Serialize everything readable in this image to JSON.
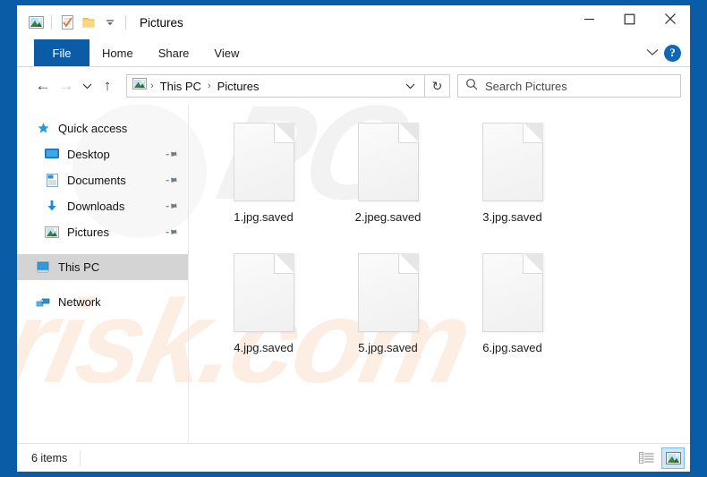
{
  "window": {
    "title": "Pictures",
    "quick_access_toolbar": [
      {
        "name": "pictures-folder-icon",
        "label": "Pictures"
      },
      {
        "name": "properties-icon",
        "label": "Properties"
      },
      {
        "name": "new-folder-icon",
        "label": "New folder"
      },
      {
        "name": "customize-dropdown-icon",
        "label": "Customize Quick Access Toolbar"
      }
    ],
    "controls": {
      "minimize": "─",
      "maximize": "□",
      "close": "✕"
    }
  },
  "ribbon": {
    "tabs": [
      {
        "label": "File",
        "selected": true
      },
      {
        "label": "Home",
        "selected": false
      },
      {
        "label": "Share",
        "selected": false
      },
      {
        "label": "View",
        "selected": false
      }
    ],
    "expand_label": "⌄",
    "help_label": "?"
  },
  "address": {
    "back_label": "←",
    "forward_label": "→",
    "recent_label": "⌄",
    "up_label": "↑",
    "breadcrumb": [
      "This PC",
      "Pictures"
    ],
    "separator": "›",
    "dropdown_label": "⌄",
    "refresh_label": "↻"
  },
  "search": {
    "placeholder": "Search Pictures",
    "value": "",
    "icon_label": "⌕"
  },
  "sidebar": {
    "items": [
      {
        "label": "Quick access",
        "icon": "star-pin-icon",
        "pinned": false,
        "selected": false,
        "indent": false
      },
      {
        "label": "Desktop",
        "icon": "desktop-icon",
        "pinned": true,
        "selected": false,
        "indent": true
      },
      {
        "label": "Documents",
        "icon": "documents-icon",
        "pinned": true,
        "selected": false,
        "indent": true
      },
      {
        "label": "Downloads",
        "icon": "downloads-icon",
        "pinned": true,
        "selected": false,
        "indent": true
      },
      {
        "label": "Pictures",
        "icon": "pictures-icon",
        "pinned": true,
        "selected": false,
        "indent": true
      },
      {
        "label": "This PC",
        "icon": "this-pc-icon",
        "pinned": false,
        "selected": true,
        "indent": false
      },
      {
        "label": "Network",
        "icon": "network-icon",
        "pinned": false,
        "selected": false,
        "indent": false
      }
    ],
    "pin_glyph": "✐"
  },
  "files": [
    {
      "name": "1.jpg.saved",
      "icon": "blank-document-icon"
    },
    {
      "name": "2.jpeg.saved",
      "icon": "blank-document-icon"
    },
    {
      "name": "3.jpg.saved",
      "icon": "blank-document-icon"
    },
    {
      "name": "4.jpg.saved",
      "icon": "blank-document-icon"
    },
    {
      "name": "5.jpg.saved",
      "icon": "blank-document-icon"
    },
    {
      "name": "6.jpg.saved",
      "icon": "blank-document-icon"
    }
  ],
  "status": {
    "item_count": "6 items",
    "views": [
      {
        "name": "details-view-button",
        "active": false
      },
      {
        "name": "large-icons-view-button",
        "active": true
      }
    ]
  },
  "watermark": {
    "top_text": "PC",
    "bottom_text": "risk.com"
  },
  "colors": {
    "accent_blue": "#0b5ca7",
    "selected_row": "#d4d4d4",
    "view_active": "#cde8f8",
    "watermark_peach": "#fdeee3"
  }
}
